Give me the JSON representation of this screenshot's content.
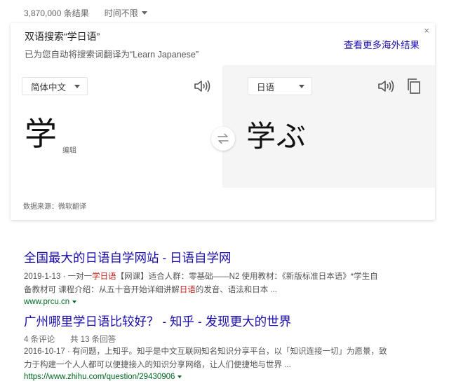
{
  "topbar": {
    "result_count": "3,870,000 条结果",
    "time_filter": "时间不限"
  },
  "card": {
    "title": "双语搜索“学日语”",
    "subtitle": "已为您自动将搜索词翻译为“Learn Japanese”",
    "more_link": "查看更多海外结果",
    "close": "×",
    "source_lang": "简体中文",
    "target_lang": "日语",
    "source_text": "学",
    "edit_label": "编辑",
    "target_text": "学ぶ",
    "data_source": "数据来源：微软翻译"
  },
  "results": [
    {
      "title": "全国最大的日语自学网站 - 日语自学网",
      "snippet_line1_pre": "2019-1-13 · 一对一",
      "snippet_line1_em": "学日语",
      "snippet_line1_post": "【网课】适合人群：零基础——N2 使用教材：《新版标准日本语》*学生自",
      "snippet_line2_pre": "备教材可 课程介绍：从五十音开始详细讲解",
      "snippet_line2_em": "日语",
      "snippet_line2_post": "的发音、语法和日本 ...",
      "url": "www.prcu.cn"
    },
    {
      "title": "广州哪里学日语比较好？ - 知乎 - 发现更大的世界",
      "comments": "4 条评论",
      "answers": "共 13 条回答",
      "snippet_line1": "2016-10-17 · 有问题，上知乎。知乎是中文互联网知名知识分享平台，以「知识连接一切」为愿景，致",
      "snippet_line2": "力于构建一个人人都可以便捷接入的知识分享网络，让人们便捷地与世界 ...",
      "url": "https://www.zhihu.com/question/29430906"
    }
  ],
  "icons": {
    "speaker": "speaker-icon",
    "copy": "copy-icon",
    "swap": "swap-arrows-icon",
    "caret": "chevron-down-icon"
  },
  "colors": {
    "link": "#1a0dab",
    "url": "#006621",
    "highlight": "#c5211b",
    "target_pane_bg": "#f5f5f5"
  }
}
